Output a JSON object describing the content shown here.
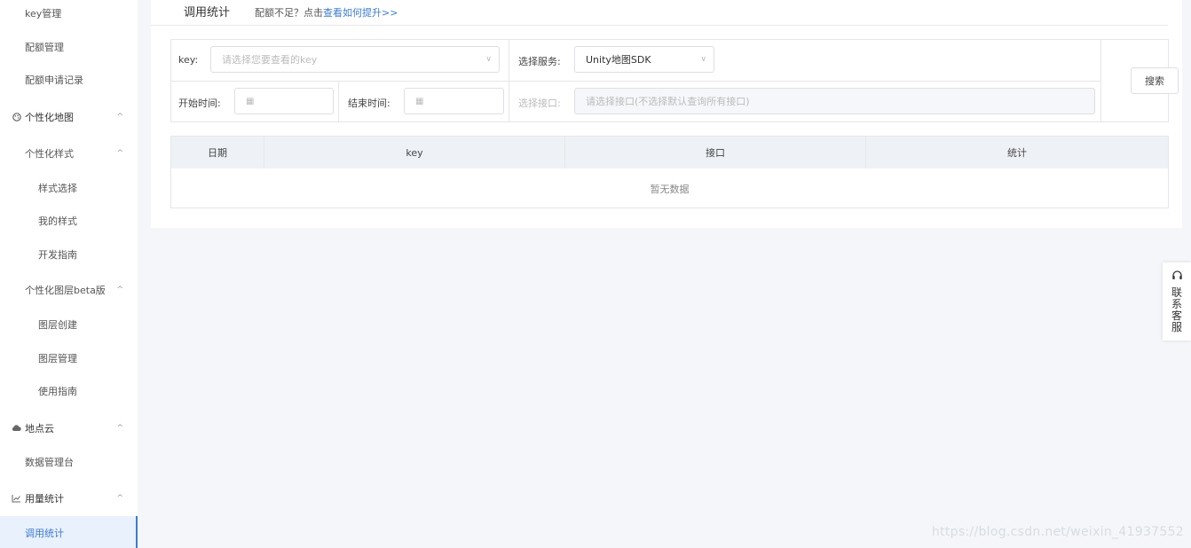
{
  "sidebar": {
    "items": [
      {
        "label": "key管理"
      },
      {
        "label": "配额管理"
      },
      {
        "label": "配额申请记录"
      },
      {
        "label": "个性化地图",
        "icon": "palette-icon"
      },
      {
        "label": "个性化样式"
      },
      {
        "label": "样式选择"
      },
      {
        "label": "我的样式"
      },
      {
        "label": "开发指南"
      },
      {
        "label": "个性化图层beta版"
      },
      {
        "label": "图层创建"
      },
      {
        "label": "图层管理"
      },
      {
        "label": "使用指南"
      },
      {
        "label": "地点云",
        "icon": "cloud-icon"
      },
      {
        "label": "数据管理台"
      },
      {
        "label": "用量统计",
        "icon": "line-chart-icon"
      },
      {
        "label": "调用统计",
        "active": true
      }
    ]
  },
  "header": {
    "title": "调用统计",
    "note_prefix": "配额不足？点击",
    "note_link": "查看如何提升>>"
  },
  "filters": {
    "key_label": "key:",
    "key_placeholder": "请选择您要查看的key",
    "service_label": "选择服务:",
    "service_value": "Unity地图SDK",
    "start_label": "开始时间:",
    "end_label": "结束时间:",
    "api_label": "选择接口:",
    "api_placeholder": "请选择接口(不选择默认查询所有接口)",
    "search_label": "搜索"
  },
  "table": {
    "columns": [
      "日期",
      "key",
      "接口",
      "统计"
    ],
    "empty_text": "暂无数据"
  },
  "support": {
    "label": "联系客服"
  },
  "watermark": "https://blog.csdn.net/weixin_41937552",
  "colors": {
    "accent": "#3a7bd5",
    "page_bg": "#f4f6f9"
  }
}
